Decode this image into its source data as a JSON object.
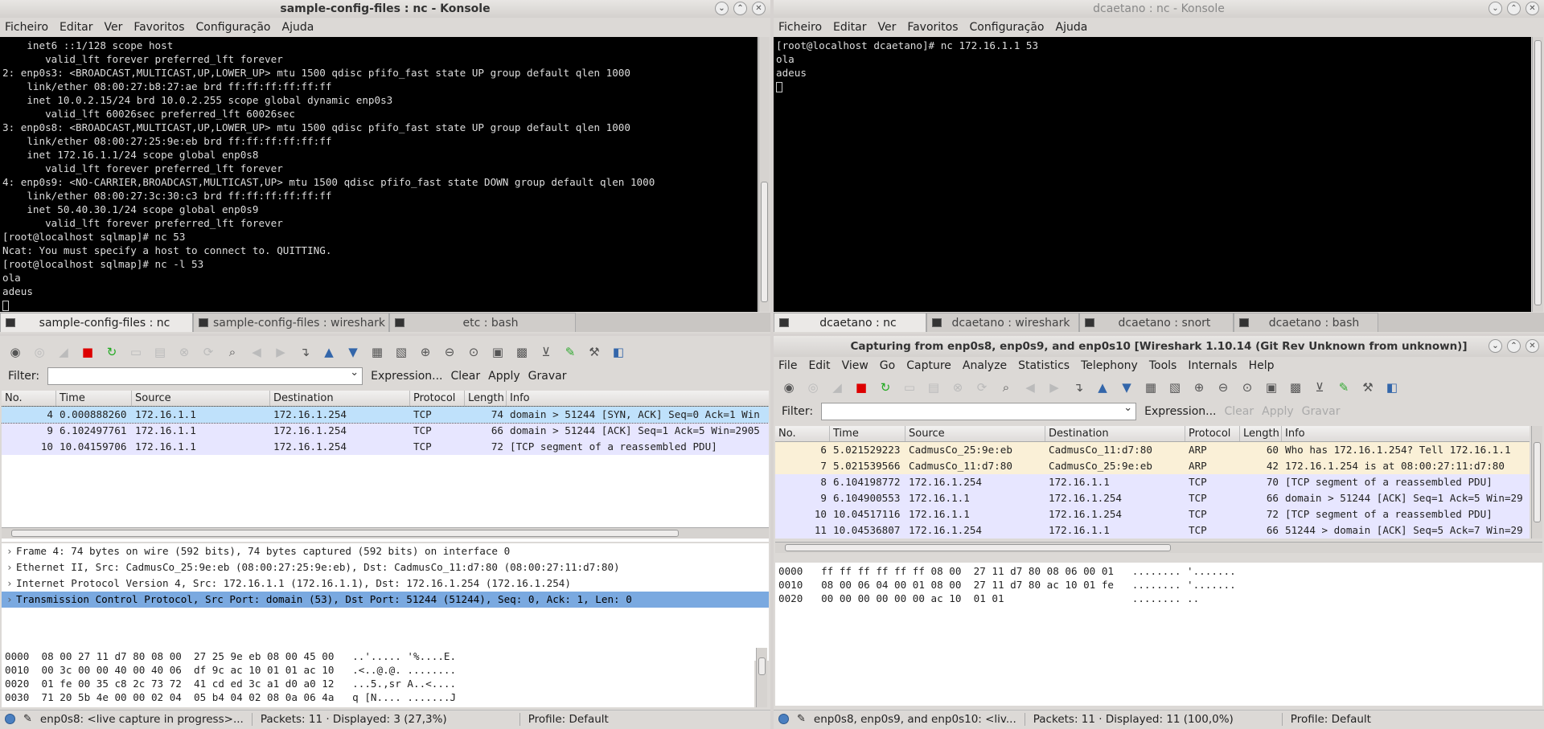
{
  "left_konsole": {
    "title": "sample-config-files : nc - Konsole",
    "menu": [
      "Ficheiro",
      "Editar",
      "Ver",
      "Favoritos",
      "Configuração",
      "Ajuda"
    ],
    "terminal_lines": [
      "    inet6 ::1/128 scope host",
      "       valid_lft forever preferred_lft forever",
      "2: enp0s3: <BROADCAST,MULTICAST,UP,LOWER_UP> mtu 1500 qdisc pfifo_fast state UP group default qlen 1000",
      "    link/ether 08:00:27:b8:27:ae brd ff:ff:ff:ff:ff:ff",
      "    inet 10.0.2.15/24 brd 10.0.2.255 scope global dynamic enp0s3",
      "       valid_lft 60026sec preferred_lft 60026sec",
      "3: enp0s8: <BROADCAST,MULTICAST,UP,LOWER_UP> mtu 1500 qdisc pfifo_fast state UP group default qlen 1000",
      "    link/ether 08:00:27:25:9e:eb brd ff:ff:ff:ff:ff:ff",
      "    inet 172.16.1.1/24 scope global enp0s8",
      "       valid_lft forever preferred_lft forever",
      "4: enp0s9: <NO-CARRIER,BROADCAST,MULTICAST,UP> mtu 1500 qdisc pfifo_fast state DOWN group default qlen 1000",
      "    link/ether 08:00:27:3c:30:c3 brd ff:ff:ff:ff:ff:ff",
      "    inet 50.40.30.1/24 scope global enp0s9",
      "       valid_lft forever preferred_lft forever",
      "[root@localhost sqlmap]# nc 53",
      "Ncat: You must specify a host to connect to. QUITTING.",
      "[root@localhost sqlmap]# nc -l 53",
      "ola",
      "adeus"
    ],
    "tabs": [
      "sample-config-files : nc",
      "sample-config-files : wireshark",
      "etc : bash"
    ]
  },
  "right_konsole": {
    "title": "dcaetano : nc - Konsole",
    "menu": [
      "Ficheiro",
      "Editar",
      "Ver",
      "Favoritos",
      "Configuração",
      "Ajuda"
    ],
    "terminal_lines": [
      "[root@localhost dcaetano]# nc 172.16.1.1 53",
      "ola",
      "adeus"
    ],
    "tabs": [
      "dcaetano : nc",
      "dcaetano : wireshark",
      "dcaetano : snort",
      "dcaetano : bash"
    ]
  },
  "left_wireshark": {
    "filter_label": "Filter:",
    "filter_value": "",
    "filter_buttons": [
      "Expression...",
      "Clear",
      "Apply",
      "Gravar"
    ],
    "columns": [
      "No.",
      "Time",
      "Source",
      "Destination",
      "Protocol",
      "Length",
      "Info"
    ],
    "packets": [
      {
        "no": "4",
        "time": "0.000888260",
        "src": "172.16.1.1",
        "dst": "172.16.1.254",
        "proto": "TCP",
        "len": "74",
        "info": "domain > 51244 [SYN, ACK] Seq=0 Ack=1 Win"
      },
      {
        "no": "9",
        "time": "6.102497761",
        "src": "172.16.1.1",
        "dst": "172.16.1.254",
        "proto": "TCP",
        "len": "66",
        "info": "domain > 51244 [ACK] Seq=1 Ack=5 Win=2905"
      },
      {
        "no": "10",
        "time": "10.04159706",
        "src": "172.16.1.1",
        "dst": "172.16.1.254",
        "proto": "TCP",
        "len": "72",
        "info": "[TCP segment of a reassembled PDU]"
      }
    ],
    "details": [
      "Frame 4: 74 bytes on wire (592 bits), 74 bytes captured (592 bits) on interface 0",
      "Ethernet II, Src: CadmusCo_25:9e:eb (08:00:27:25:9e:eb), Dst: CadmusCo_11:d7:80 (08:00:27:11:d7:80)",
      "Internet Protocol Version 4, Src: 172.16.1.1 (172.16.1.1), Dst: 172.16.1.254 (172.16.1.254)",
      "Transmission Control Protocol, Src Port: domain (53), Dst Port: 51244 (51244), Seq: 0, Ack: 1, Len: 0"
    ],
    "hex_lines": [
      "0000  08 00 27 11 d7 80 08 00  27 25 9e eb 08 00 45 00   ..'..... '%....E.",
      "0010  00 3c 00 00 40 00 40 06  df 9c ac 10 01 01 ac 10   .<..@.@. ........",
      "0020  01 fe 00 35 c8 2c 73 72  41 cd ed 3c a1 d0 a0 12   ...5.,sr A..<....",
      "0030  71 20 5b 4e 00 00 02 04  05 b4 04 02 08 0a 06 4a   q [N.... .......J"
    ],
    "status_iface": "enp0s8: <live capture in progress>...",
    "status_packets": "Packets: 11 · Displayed: 3 (27,3%)",
    "status_profile": "Profile: Default"
  },
  "right_wireshark": {
    "title": "Capturing from enp0s8, enp0s9, and enp0s10   [Wireshark 1.10.14  (Git Rev Unknown from unknown)]",
    "menu": [
      "File",
      "Edit",
      "View",
      "Go",
      "Capture",
      "Analyze",
      "Statistics",
      "Telephony",
      "Tools",
      "Internals",
      "Help"
    ],
    "filter_label": "Filter:",
    "filter_value": "",
    "filter_buttons": [
      "Expression...",
      "Clear",
      "Apply",
      "Gravar"
    ],
    "columns": [
      "No.",
      "Time",
      "Source",
      "Destination",
      "Protocol",
      "Length",
      "Info"
    ],
    "packets": [
      {
        "no": "6",
        "time": "5.021529223",
        "src": "CadmusCo_25:9e:eb",
        "dst": "CadmusCo_11:d7:80",
        "proto": "ARP",
        "len": "60",
        "info": "Who has 172.16.1.254?  Tell 172.16.1.1",
        "kind": "arp"
      },
      {
        "no": "7",
        "time": "5.021539566",
        "src": "CadmusCo_11:d7:80",
        "dst": "CadmusCo_25:9e:eb",
        "proto": "ARP",
        "len": "42",
        "info": "172.16.1.254 is at 08:00:27:11:d7:80",
        "kind": "arp"
      },
      {
        "no": "8",
        "time": "6.104198772",
        "src": "172.16.1.254",
        "dst": "172.16.1.1",
        "proto": "TCP",
        "len": "70",
        "info": "[TCP segment of a reassembled PDU]",
        "kind": "tcp"
      },
      {
        "no": "9",
        "time": "6.104900553",
        "src": "172.16.1.1",
        "dst": "172.16.1.254",
        "proto": "TCP",
        "len": "66",
        "info": "domain > 51244 [ACK] Seq=1 Ack=5 Win=29",
        "kind": "tcp"
      },
      {
        "no": "10",
        "time": "10.04517116",
        "src": "172.16.1.1",
        "dst": "172.16.1.254",
        "proto": "TCP",
        "len": "72",
        "info": "[TCP segment of a reassembled PDU]",
        "kind": "tcp"
      },
      {
        "no": "11",
        "time": "10.04536807",
        "src": "172.16.1.254",
        "dst": "172.16.1.1",
        "proto": "TCP",
        "len": "66",
        "info": "51244 > domain [ACK] Seq=5 Ack=7 Win=29",
        "kind": "tcp"
      }
    ],
    "hex_lines": [
      "0000   ff ff ff ff ff ff 08 00  27 11 d7 80 08 06 00 01   ........ '.......",
      "0010   08 00 06 04 00 01 08 00  27 11 d7 80 ac 10 01 fe   ........ '.......",
      "0020   00 00 00 00 00 00 ac 10  01 01                     ........ .."
    ],
    "status_iface": "enp0s8, enp0s9, and enp0s10: <liv...",
    "status_packets": "Packets: 11 · Displayed: 11 (100,0%)",
    "status_profile": "Profile: Default"
  },
  "colors": {
    "selected_row": "#bfe1fb",
    "tcp_row": "#e7e6ff",
    "arp_row": "#faf0d7",
    "detail_sel": "#7aa9e0"
  }
}
